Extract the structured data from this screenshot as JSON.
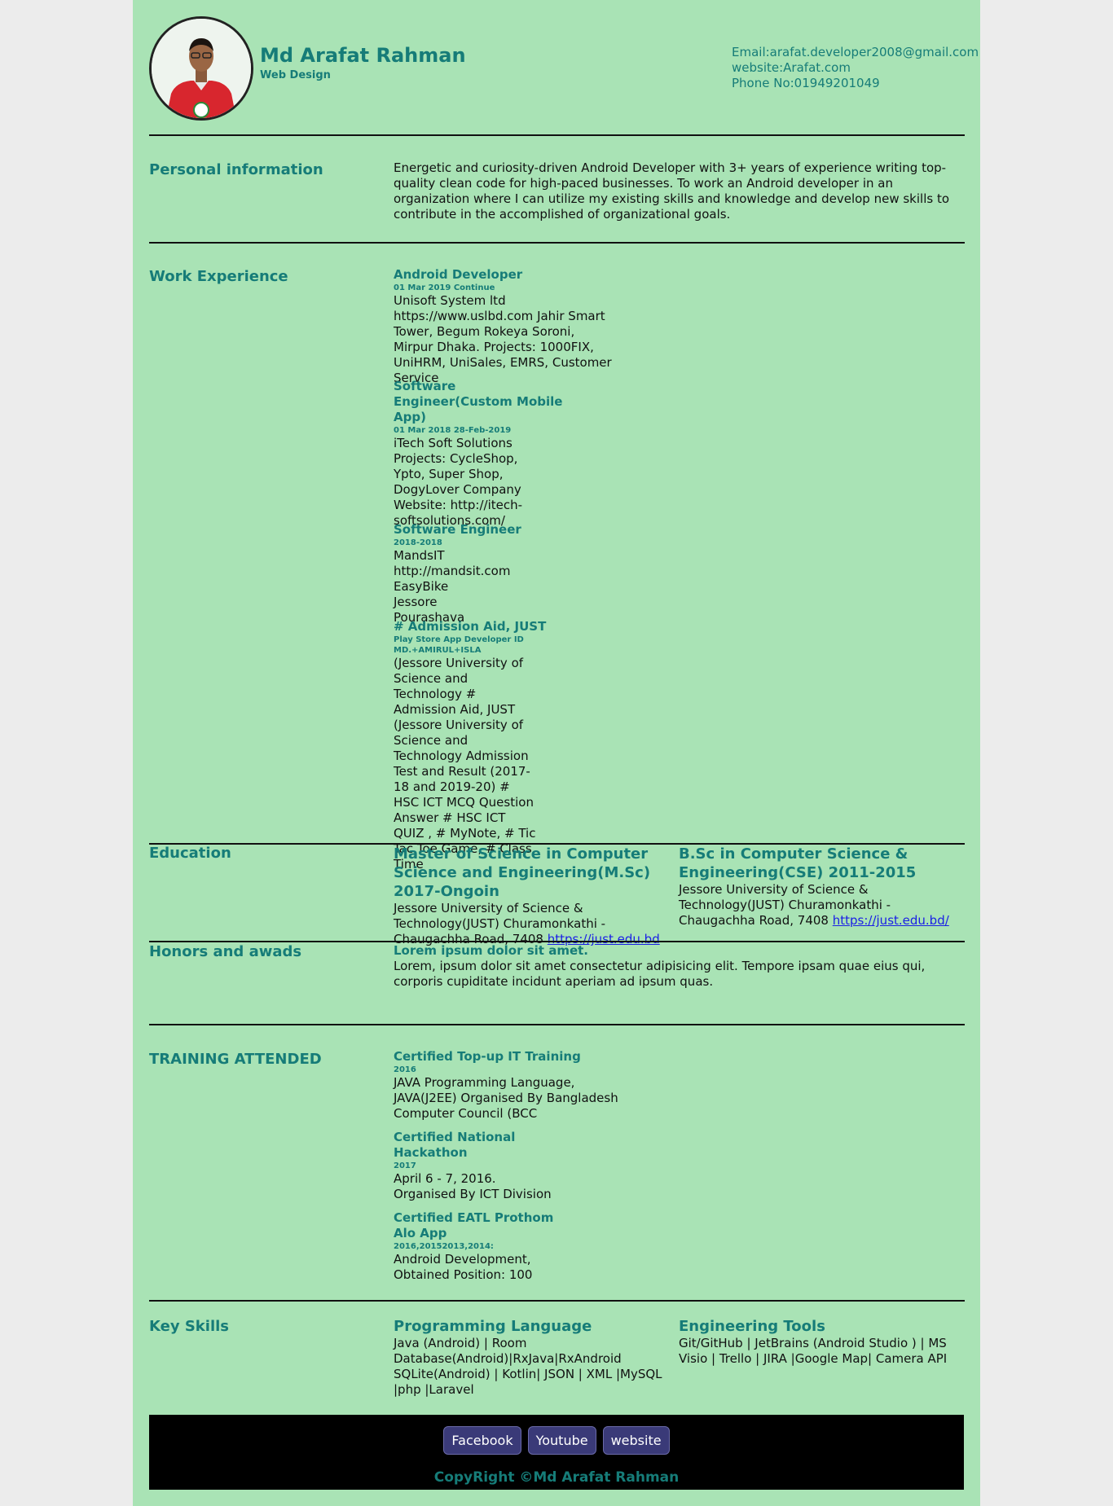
{
  "header": {
    "name": "Md Arafat Rahman",
    "role": "Web Design",
    "email": "Email:arafat.developer2008@gmail.com",
    "website": "website:Arafat.com",
    "phone": "Phone No:01949201049"
  },
  "personal": {
    "title": "Personal information",
    "text": "Energetic and curiosity-driven Android Developer with 3+ years of experience writing top-quality clean code for high-paced businesses. To work an Android developer in an organization where I can utilize my existing skills and knowledge and develop new skills to contribute in the accomplished of organizational goals."
  },
  "work": {
    "title": "Work Experience",
    "jobs": [
      {
        "title": "Android Developer",
        "date": "01 Mar 2019 Continue",
        "desc": "Unisoft System ltd https://www.uslbd.com Jahir Smart Tower, Begum Rokeya Soroni, Mirpur Dhaka. Projects: 1000FIX, UniHRM, UniSales, EMRS, Customer Service"
      },
      {
        "title": "Software Engineer(Custom Mobile App)",
        "date": "01 Mar 2018 28-Feb-2019",
        "desc": "iTech Soft Solutions Projects: CycleShop, Ypto, Super Shop, DogyLover Company Website: http://itech-softsolutions.com/"
      },
      {
        "title": "Software Engineer",
        "date": "2018-2018",
        "desc": "MandsIT http://mandsit.com EasyBike Jessore Pourashava"
      },
      {
        "title": "# Admission Aid, JUST",
        "date": "Play Store App Developer ID",
        "date2": "MD.+AMIRUL+ISLA",
        "desc": "(Jessore University of Science and Technology # Admission Aid, JUST (Jessore University of Science and Technology Admission Test and Result (2017-18 and 2019-20) # HSC ICT MCQ Question Answer # HSC ICT QUIZ , # MyNote, # Tic Tac Toe Game, # Class Time"
      }
    ]
  },
  "education": {
    "title": "Education",
    "items": [
      {
        "degree": "Master of Science in Computer Science and Engineering(M.Sc) 2017-Ongoin",
        "desc": "Jessore University of Science & Technology(JUST) Churamonkathi - Chaugachha Road, 7408",
        "link": "https://just.edu.bd"
      },
      {
        "degree": "B.Sc in Computer Science & Engineering(CSE) 2011-2015",
        "desc": "Jessore University of Science & Technology(JUST) Churamonkathi - Chaugachha Road, 7408",
        "link": "https://just.edu.bd/"
      }
    ]
  },
  "honors": {
    "title": "Honors and awads",
    "heading": "Lorem ipsum dolor sit amet.",
    "text": "Lorem, ipsum dolor sit amet consectetur adipisicing elit. Tempore ipsam quae eius qui, corporis cupiditate incidunt aperiam ad ipsum quas."
  },
  "training": {
    "title": "TRAINING ATTENDED",
    "items": [
      {
        "title": "Certified Top-up IT Training",
        "date": "2016",
        "desc": "JAVA Programming Language, JAVA(J2EE) Organised By Bangladesh Computer Council (BCC"
      },
      {
        "title": "Certified National Hackathon",
        "date": "2017",
        "desc": "April 6 - 7, 2016. Organised By ICT Division"
      },
      {
        "title": "Certified EATL Prothom Alo App",
        "date": "2016,20152013,2014:",
        "desc": "Android Development, Obtained Position: 100"
      }
    ]
  },
  "skills": {
    "title": "Key Skills",
    "items": [
      {
        "title": "Programming Language",
        "desc": "Java (Android) | Room Database(Android)|RxJava|RxAndroid SQLite(Android) | Kotlin| JSON | XML |MySQL |php |Laravel"
      },
      {
        "title": "Engineering Tools",
        "desc": "Git/GitHub | JetBrains (Android Studio ) | MS Visio | Trello | JIRA |Google Map| Camera API"
      }
    ]
  },
  "footer": {
    "buttons": [
      "Facebook",
      "Youtube",
      "website"
    ],
    "copyright": "CopyRight ©Md Arafat Rahman"
  },
  "colors": {
    "background": "#a9e3b5",
    "accent": "#167c78",
    "footer": "#000000",
    "button": "#3a3a78"
  },
  "icons": {
    "profile_photo": "avatar"
  }
}
